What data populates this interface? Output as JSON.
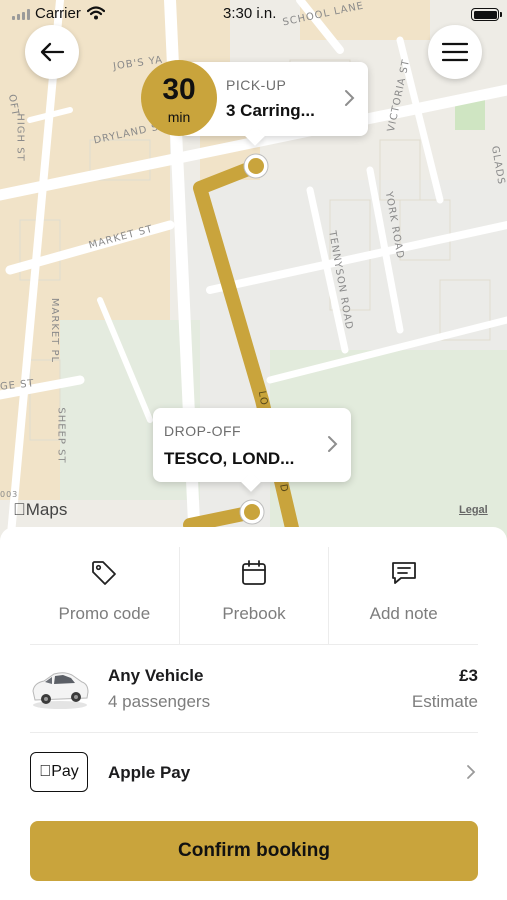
{
  "status_bar": {
    "carrier": "Carrier",
    "time": "3:30 i.n."
  },
  "map": {
    "streets": [
      "JOB'S YA",
      "DRYLAND ST",
      "MARKET ST",
      "HIGH ST",
      "MARKET PL",
      "SHEEP ST",
      "GE ST",
      "SCHOOL LANE",
      "VICTORIA ST",
      "TENNYSON ROAD",
      "YORK ROAD",
      "GLADS",
      "OFT",
      "LO",
      "D",
      "003"
    ],
    "attribution": "Maps",
    "legal": "Legal",
    "route_color": "#c9a43c"
  },
  "eta": {
    "value": "30",
    "unit": "min"
  },
  "pickup": {
    "caption": "PICK-UP",
    "address": "3 Carring..."
  },
  "dropoff": {
    "caption": "DROP-OFF",
    "address": "TESCO, LOND..."
  },
  "actions": [
    {
      "label": "Promo code",
      "icon": "tag-icon"
    },
    {
      "label": "Prebook",
      "icon": "calendar-icon"
    },
    {
      "label": "Add note",
      "icon": "note-icon"
    }
  ],
  "vehicle": {
    "name": "Any Vehicle",
    "passengers": "4 passengers",
    "price": "£3",
    "price_note": "Estimate"
  },
  "payment": {
    "badge": "Pay",
    "label": "Apple Pay"
  },
  "confirm_label": "Confirm booking",
  "colors": {
    "accent": "#c9a43c"
  }
}
